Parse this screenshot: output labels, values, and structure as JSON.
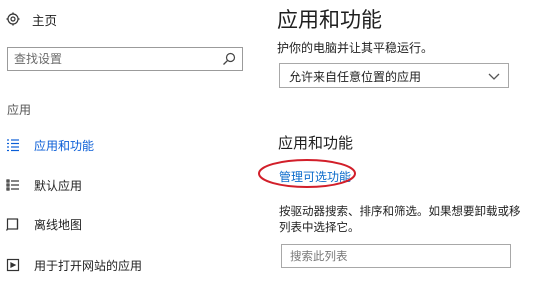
{
  "sidebar": {
    "home_label": "主页",
    "home_icon": "gear-icon",
    "search_placeholder": "查找设置",
    "search_icon": "search-icon",
    "section_label": "应用",
    "items": [
      {
        "label": "应用和功能",
        "icon": "apps-list-icon",
        "active": true
      },
      {
        "label": "默认应用",
        "icon": "default-apps-icon",
        "active": false
      },
      {
        "label": "离线地图",
        "icon": "offline-map-icon",
        "active": false
      },
      {
        "label": "用于打开网站的应用",
        "icon": "app-for-websites-icon",
        "active": false
      }
    ]
  },
  "main": {
    "title": "应用和功能",
    "install_text": "护你的电脑并让其平稳运行。",
    "install_dropdown_value": "允许来自任意位置的应用",
    "section_title": "应用和功能",
    "manage_link": "管理可选功能",
    "help_line1": "按驱动器搜索、排序和筛选。如果想要卸载或移",
    "help_line2": "列表中选择它。",
    "list_search_placeholder": "搜索此列表"
  },
  "colors": {
    "accent": "#0b5ed7",
    "link": "#0b6bcb",
    "highlight": "#d21f2a"
  }
}
